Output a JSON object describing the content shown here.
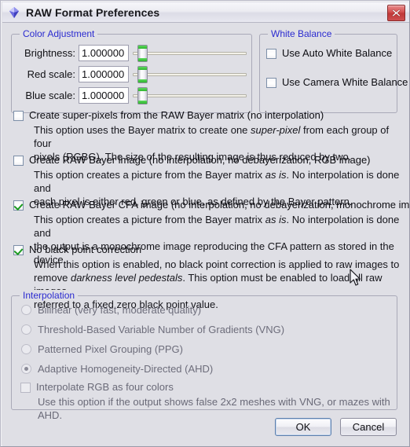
{
  "window": {
    "title": "RAW Format Preferences",
    "app_icon": "diamond-gem-icon",
    "close_label": "✕"
  },
  "color_adjustment": {
    "title": "Color Adjustment",
    "fields": [
      {
        "label": "Brightness:",
        "value": "1.000000"
      },
      {
        "label": "Red scale:",
        "value": "1.000000"
      },
      {
        "label": "Blue scale:",
        "value": "1.000000"
      }
    ]
  },
  "white_balance": {
    "title": "White Balance",
    "options": [
      {
        "label": "Use Auto White Balance",
        "checked": false
      },
      {
        "label": "Use Camera White Balance",
        "checked": false
      }
    ]
  },
  "options": [
    {
      "label": "Create super-pixels from the RAW Bayer matrix (no interpolation)",
      "checked": false,
      "desc_line1_a": "This option uses the Bayer matrix to create one ",
      "desc_line1_em": "super-pixel",
      "desc_line1_b": " from each group of four",
      "desc_line2": "pixels (RGBG). The size of the resulting image is thus reduced by two."
    },
    {
      "label": "Create RAW Bayer image (no interpolation, no debayerization, RGB image)",
      "checked": false,
      "desc_line1_a": "This option creates a picture from the Bayer matrix ",
      "desc_line1_em": "as is",
      "desc_line1_b": ". No interpolation is done and",
      "desc_line2": "each pixel is either red, green or blue, as defined by the Bayer pattern."
    },
    {
      "label": "Create RAW Bayer CFA image (no interpolation, no debayerization, monochrome image)",
      "checked": true,
      "desc_line1_a": "This option creates a picture from the Bayer matrix ",
      "desc_line1_em": "as is",
      "desc_line1_b": ". No interpolation is done and",
      "desc_line2": "the output is a monochrome image reproducing the CFA pattern as stored in the device."
    },
    {
      "label": "No black point correction",
      "checked": true,
      "desc_line1_a": "When this option is enabled, no black point correction is applied to raw images to",
      "desc_line1_em": "",
      "desc_line1_b": "",
      "desc_line2a": "remove ",
      "desc_line2_em": "darkness level pedestals",
      "desc_line2b": ". This option must be enabled to load all raw images",
      "desc_line3": "referred to a fixed zero black point value."
    }
  ],
  "interpolation": {
    "title": "Interpolation",
    "radios": [
      {
        "label": "Bilinear (very fast, moderate quality)",
        "selected": false
      },
      {
        "label": "Threshold-Based Variable Number of Gradients (VNG)",
        "selected": false
      },
      {
        "label": "Patterned Pixel Grouping (PPG)",
        "selected": false
      },
      {
        "label": "Adaptive Homogeneity-Directed (AHD)",
        "selected": true
      }
    ],
    "four_colors": {
      "label": "Interpolate RGB as four colors",
      "checked": false,
      "desc": "Use this option if the output shows false 2x2 meshes with VNG, or mazes with AHD."
    }
  },
  "buttons": {
    "ok": "OK",
    "cancel": "Cancel"
  },
  "colors": {
    "group_title": "#2b2bd0",
    "dialog_bg": "#dfdfe5",
    "close_red": "#bf3838",
    "check_green": "#1d9b22",
    "slider_green": "#2eb52e"
  }
}
